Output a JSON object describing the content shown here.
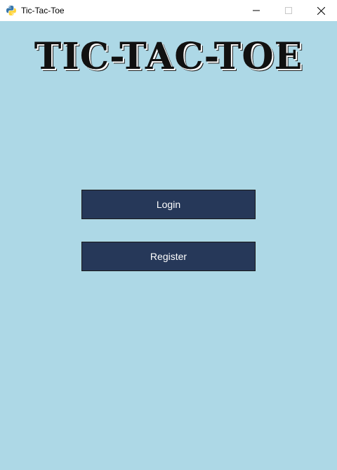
{
  "window": {
    "title": "Tic-Tac-Toe",
    "app_icon": "python-icon",
    "controls": [
      "minimize-icon",
      "maximize-icon",
      "close-icon"
    ]
  },
  "main": {
    "heading": "TIC-TAC-TOE",
    "login_label": "Login",
    "register_label": "Register"
  },
  "colors": {
    "background": "#ADD8E6",
    "button": "#263859",
    "button_text": "#FFFFFF",
    "heading": "#111111"
  }
}
